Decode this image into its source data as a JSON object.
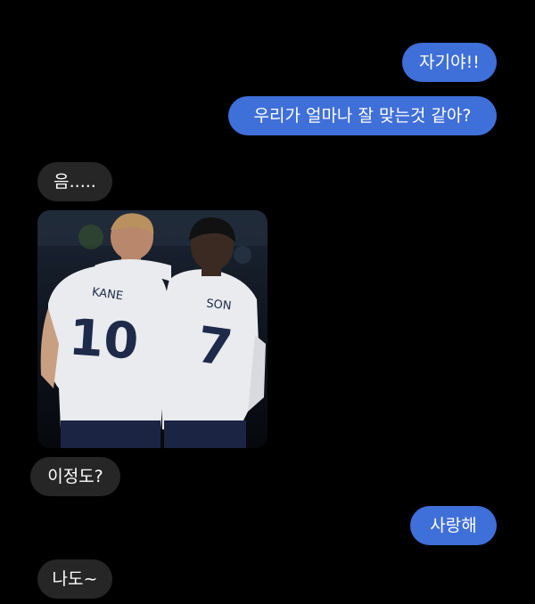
{
  "messages": [
    {
      "id": "m1",
      "side": "out",
      "text": "자기야!!"
    },
    {
      "id": "m2",
      "side": "out",
      "text": "우리가 얼마나 잘 맞는것 같아?"
    },
    {
      "id": "m3",
      "side": "in",
      "text": "음....."
    },
    {
      "id": "m4",
      "side": "in",
      "type": "image",
      "jerseys": [
        {
          "name": "KANE",
          "number": "10"
        },
        {
          "name": "SON",
          "number": "7"
        }
      ]
    },
    {
      "id": "m5",
      "side": "in",
      "text": "이정도?"
    },
    {
      "id": "m6",
      "side": "out",
      "text": "사랑해"
    },
    {
      "id": "m7",
      "side": "in",
      "text": "나도~"
    }
  ],
  "colors": {
    "background": "#000000",
    "outgoing_bubble": "#3f6fd8",
    "incoming_bubble": "#262626",
    "text": "#ffffff"
  }
}
